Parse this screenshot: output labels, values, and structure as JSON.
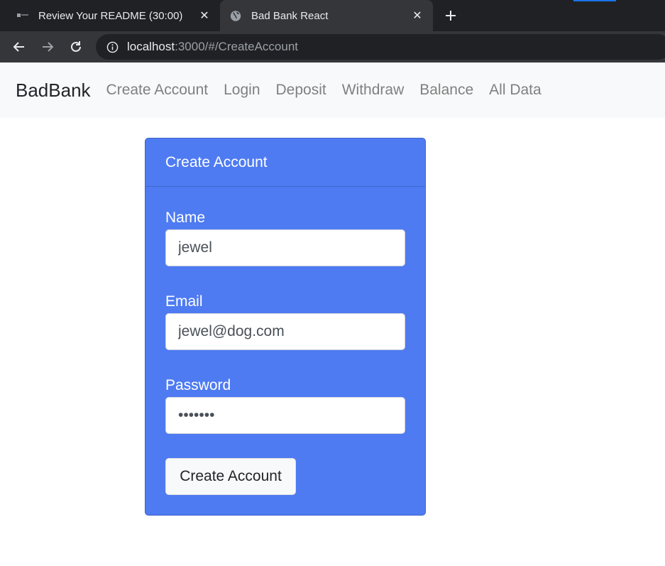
{
  "browser": {
    "tabs": [
      {
        "title": "Review Your README (30:00)",
        "favicon": "site-favicon"
      },
      {
        "title": "Bad Bank React",
        "favicon": "globe-icon"
      }
    ],
    "active_tab": 1,
    "url_host": "localhost",
    "url_rest": ":3000/#/CreateAccount",
    "colors": {
      "chrome_dark": "#202124",
      "chrome_active": "#35363a"
    }
  },
  "navbar": {
    "brand": "BadBank",
    "links": [
      "Create Account",
      "Login",
      "Deposit",
      "Withdraw",
      "Balance",
      "All Data"
    ]
  },
  "card": {
    "header": "Create Account",
    "fields": {
      "name": {
        "label": "Name",
        "value": "jewel"
      },
      "email": {
        "label": "Email",
        "value": "jewel@dog.com"
      },
      "password": {
        "label": "Password",
        "value": "•••••••"
      }
    },
    "submit_label": "Create Account",
    "colors": {
      "card_bg": "#4e7bf2",
      "text": "#ffffff"
    }
  }
}
